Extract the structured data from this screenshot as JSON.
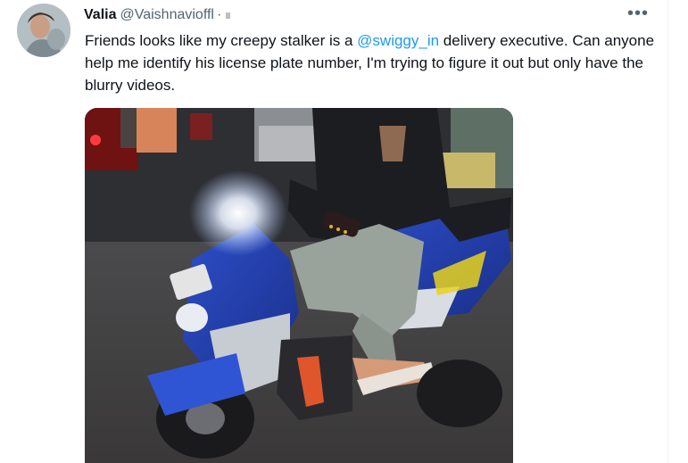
{
  "tweet": {
    "author_name": "Valia",
    "author_handle": "@Vaishnavioffl",
    "separator": "·",
    "more_icon": "more-horizontal-icon",
    "text_before": "Friends looks like my creepy stalker is a ",
    "mention": "@swiggy_in",
    "text_after": " delivery executive. Can anyone help me identify his license plate number, I'm trying to figure it out but only have the blurry videos.",
    "media": {
      "type": "photo",
      "plate_text": "",
      "scooter_badge": ""
    }
  },
  "colors": {
    "text": "#0f1419",
    "secondary": "#536471",
    "link": "#1d9bf0",
    "divider": "#eff3f4"
  }
}
